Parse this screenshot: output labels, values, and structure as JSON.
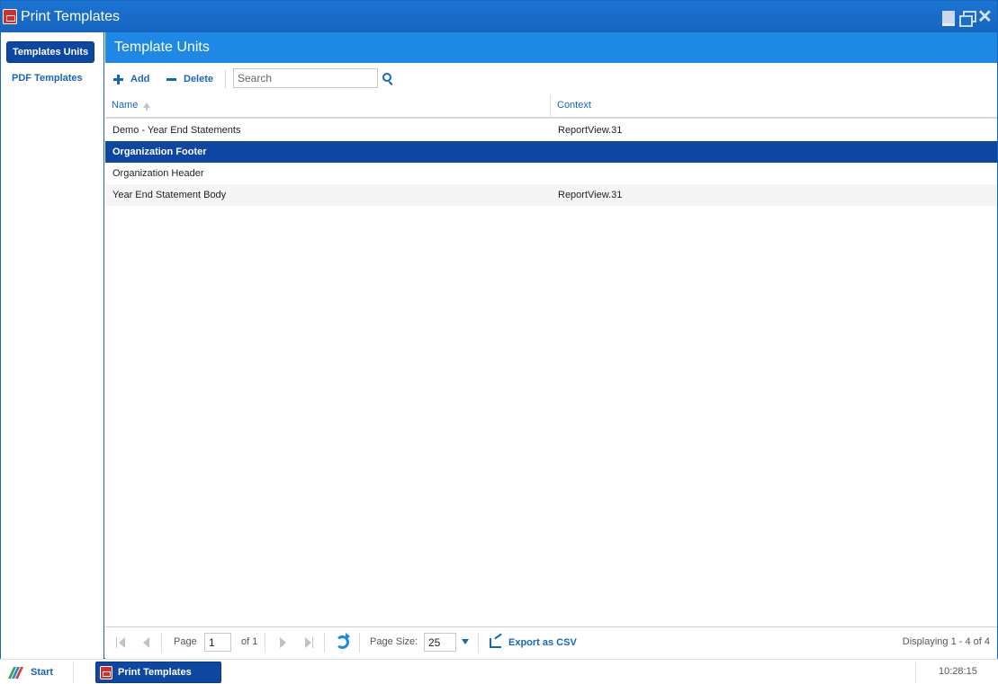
{
  "window": {
    "title": "Print Templates",
    "icon": "pdf-icon"
  },
  "sidebar": {
    "items": [
      {
        "label": "Templates Units",
        "active": true
      },
      {
        "label": "PDF Templates",
        "active": false
      }
    ]
  },
  "panel": {
    "title": "Template Units"
  },
  "toolbar": {
    "add_label": "Add",
    "delete_label": "Delete",
    "search_placeholder": "Search",
    "search_value": ""
  },
  "grid": {
    "columns": [
      "Name",
      "Context"
    ],
    "sort": {
      "column": "Name",
      "direction": "ascending"
    },
    "rows": [
      {
        "name": "Demo - Year End Statements",
        "context": "ReportView.31",
        "selected": false
      },
      {
        "name": "Organization Footer",
        "context": "",
        "selected": true
      },
      {
        "name": "Organization Header",
        "context": "",
        "selected": false
      },
      {
        "name": "Year End Statement Body",
        "context": "ReportView.31",
        "selected": false
      }
    ]
  },
  "pager": {
    "page_label": "Page",
    "page_value": "1",
    "of_label": "of 1",
    "page_size_label": "Page Size:",
    "page_size_value": "25",
    "export_label": "Export as CSV",
    "display_info": "Displaying 1 - 4 of 4"
  },
  "taskbar": {
    "start_label": "Start",
    "task_label": "Print Templates",
    "clock": "10:28:15"
  },
  "colors": {
    "accent": "#1565c0",
    "header": "#1e88e5",
    "selected": "#0d47a1"
  }
}
